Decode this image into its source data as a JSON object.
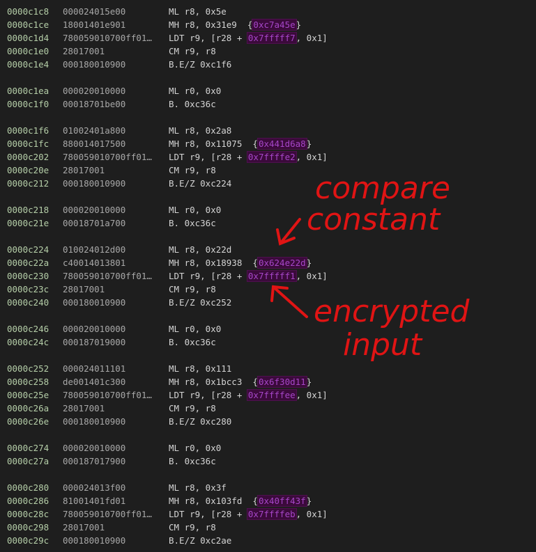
{
  "listing": [
    {
      "addr": "0000c1c8",
      "bytes": "000024015e00",
      "mnem": "ML r8, 0x5e",
      "hl": null
    },
    {
      "addr": "0000c1ce",
      "bytes": "18001401e901",
      "mnem": "MH r8, 0x31e9  ",
      "hl": "0xc7a45e",
      "brace": true
    },
    {
      "addr": "0000c1d4",
      "bytes": "780059010700ff01…",
      "mnem": "LDT r9, [r28 + ",
      "hl": "0x7fffff7",
      "post": ", 0x1]"
    },
    {
      "addr": "0000c1e0",
      "bytes": "28017001",
      "mnem": "CM r9, r8",
      "hl": null
    },
    {
      "addr": "0000c1e4",
      "bytes": "000180010900",
      "mnem": "B.E/Z 0xc1f6",
      "hl": null
    },
    {
      "blank": true
    },
    {
      "addr": "0000c1ea",
      "bytes": "000020010000",
      "mnem": "ML r0, 0x0",
      "hl": null
    },
    {
      "addr": "0000c1f0",
      "bytes": "00018701be00",
      "mnem": "B. 0xc36c",
      "hl": null
    },
    {
      "blank": true
    },
    {
      "addr": "0000c1f6",
      "bytes": "01002401a800",
      "mnem": "ML r8, 0x2a8",
      "hl": null
    },
    {
      "addr": "0000c1fc",
      "bytes": "880014017500",
      "mnem": "MH r8, 0x11075  ",
      "hl": "0x441d6a8",
      "brace": true
    },
    {
      "addr": "0000c202",
      "bytes": "780059010700ff01…",
      "mnem": "LDT r9, [r28 + ",
      "hl": "0x7ffffe2",
      "post": ", 0x1]"
    },
    {
      "addr": "0000c20e",
      "bytes": "28017001",
      "mnem": "CM r9, r8",
      "hl": null
    },
    {
      "addr": "0000c212",
      "bytes": "000180010900",
      "mnem": "B.E/Z 0xc224",
      "hl": null
    },
    {
      "blank": true
    },
    {
      "addr": "0000c218",
      "bytes": "000020010000",
      "mnem": "ML r0, 0x0",
      "hl": null
    },
    {
      "addr": "0000c21e",
      "bytes": "00018701a700",
      "mnem": "B. 0xc36c",
      "hl": null
    },
    {
      "blank": true
    },
    {
      "addr": "0000c224",
      "bytes": "010024012d00",
      "mnem": "ML r8, 0x22d",
      "hl": null
    },
    {
      "addr": "0000c22a",
      "bytes": "c40014013801",
      "mnem": "MH r8, 0x18938  ",
      "hl": "0x624e22d",
      "brace": true
    },
    {
      "addr": "0000c230",
      "bytes": "780059010700ff01…",
      "mnem": "LDT r9, [r28 + ",
      "hl": "0x7fffff1",
      "post": ", 0x1]"
    },
    {
      "addr": "0000c23c",
      "bytes": "28017001",
      "mnem": "CM r9, r8",
      "hl": null
    },
    {
      "addr": "0000c240",
      "bytes": "000180010900",
      "mnem": "B.E/Z 0xc252",
      "hl": null
    },
    {
      "blank": true
    },
    {
      "addr": "0000c246",
      "bytes": "000020010000",
      "mnem": "ML r0, 0x0",
      "hl": null
    },
    {
      "addr": "0000c24c",
      "bytes": "000187019000",
      "mnem": "B. 0xc36c",
      "hl": null
    },
    {
      "blank": true
    },
    {
      "addr": "0000c252",
      "bytes": "000024011101",
      "mnem": "ML r8, 0x111",
      "hl": null
    },
    {
      "addr": "0000c258",
      "bytes": "de001401c300",
      "mnem": "MH r8, 0x1bcc3  ",
      "hl": "0x6f30d11",
      "brace": true
    },
    {
      "addr": "0000c25e",
      "bytes": "780059010700ff01…",
      "mnem": "LDT r9, [r28 + ",
      "hl": "0x7ffffee",
      "post": ", 0x1]"
    },
    {
      "addr": "0000c26a",
      "bytes": "28017001",
      "mnem": "CM r9, r8",
      "hl": null
    },
    {
      "addr": "0000c26e",
      "bytes": "000180010900",
      "mnem": "B.E/Z 0xc280",
      "hl": null
    },
    {
      "blank": true
    },
    {
      "addr": "0000c274",
      "bytes": "000020010000",
      "mnem": "ML r0, 0x0",
      "hl": null
    },
    {
      "addr": "0000c27a",
      "bytes": "000187017900",
      "mnem": "B. 0xc36c",
      "hl": null
    },
    {
      "blank": true
    },
    {
      "addr": "0000c280",
      "bytes": "000024013f00",
      "mnem": "ML r8, 0x3f",
      "hl": null
    },
    {
      "addr": "0000c286",
      "bytes": "81001401fd01",
      "mnem": "MH r8, 0x103fd  ",
      "hl": "0x40ff43f",
      "brace": true
    },
    {
      "addr": "0000c28c",
      "bytes": "780059010700ff01…",
      "mnem": "LDT r9, [r28 + ",
      "hl": "0x7ffffeb",
      "post": ", 0x1]"
    },
    {
      "addr": "0000c298",
      "bytes": "28017001",
      "mnem": "CM r9, r8",
      "hl": null
    },
    {
      "addr": "0000c29c",
      "bytes": "000180010900",
      "mnem": "B.E/Z 0xc2ae",
      "hl": null
    }
  ],
  "annotations": {
    "compare_line1": "compare",
    "compare_line2": "constant",
    "encrypted_line1": "encrypted",
    "encrypted_line2": "input",
    "color": "#e01414"
  }
}
